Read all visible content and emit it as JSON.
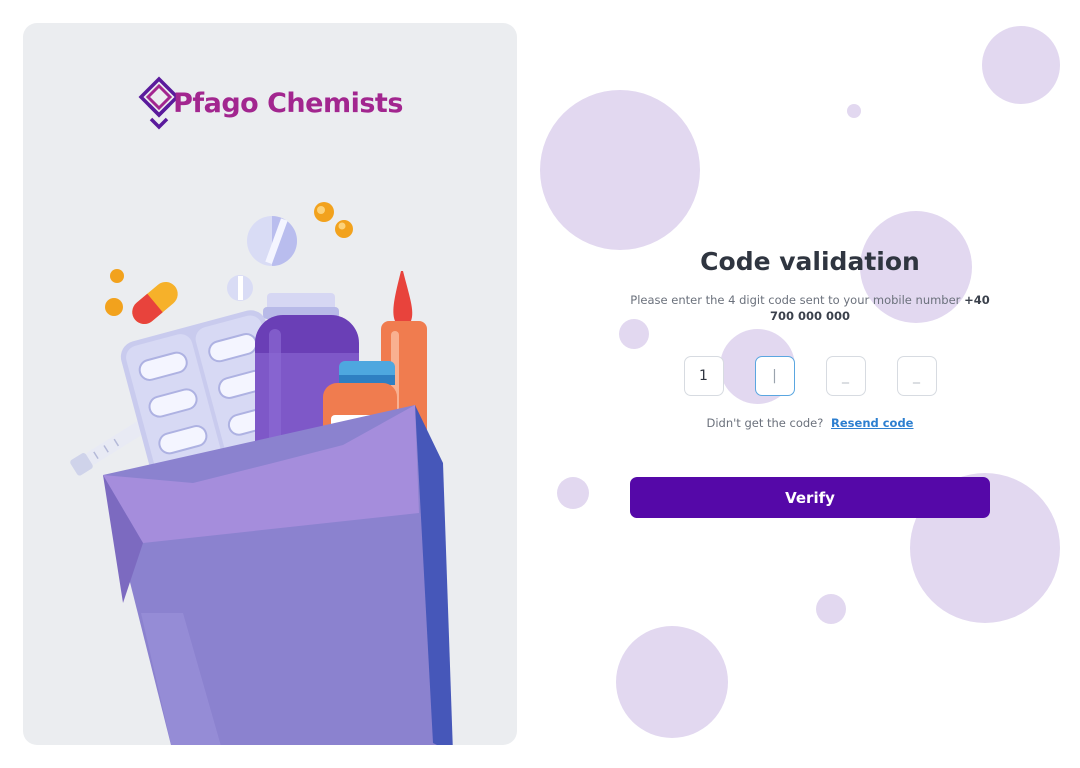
{
  "brand": {
    "name": "Pfago Chemists",
    "color": "#a2268f",
    "accent": "#5a1a9c"
  },
  "validation": {
    "title": "Code validation",
    "subtitle": "Please enter the 4 digit code sent to your mobile number",
    "phone": "+40 700 000 000",
    "code_digits": [
      "1",
      "|",
      "_",
      "_"
    ],
    "resend_prompt": "Didn't get the code?",
    "resend_link": "Resend code",
    "verify_label": "Verify"
  },
  "colors": {
    "primary_button": "#5508a8",
    "bubble": "#e2d8f0",
    "link": "#2d7fd0",
    "panel_bg": "#ebedf0"
  },
  "icons": [
    "pfago-logo-icon",
    "pharmacy-bag-illustration"
  ]
}
